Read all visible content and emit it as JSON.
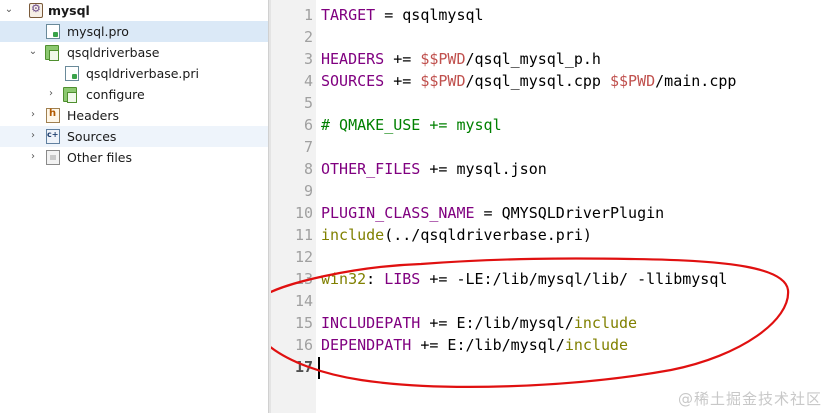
{
  "project_tree": {
    "items": [
      {
        "label": "mysql",
        "kind": "project",
        "expanded": true
      },
      {
        "label": "mysql.pro",
        "kind": "pro-file",
        "selected": true
      },
      {
        "label": "qsqldriverbase",
        "kind": "subproject",
        "expanded": true
      },
      {
        "label": "qsqldriverbase.pri",
        "kind": "pri-file"
      },
      {
        "label": "configure",
        "kind": "subproject",
        "expanded": false
      },
      {
        "label": "Headers",
        "kind": "headers-folder",
        "expanded": false
      },
      {
        "label": "Sources",
        "kind": "sources-folder",
        "expanded": false
      },
      {
        "label": "Other files",
        "kind": "other-folder",
        "expanded": false
      }
    ]
  },
  "editor": {
    "current_line": 17,
    "lines": [
      {
        "n": "1",
        "text": "TARGET = qsqlmysql"
      },
      {
        "n": "2",
        "text": ""
      },
      {
        "n": "3",
        "text": "HEADERS += $$PWD/qsql_mysql_p.h"
      },
      {
        "n": "4",
        "text": "SOURCES += $$PWD/qsql_mysql.cpp $$PWD/main.cpp"
      },
      {
        "n": "5",
        "text": ""
      },
      {
        "n": "6",
        "text": "# QMAKE_USE += mysql"
      },
      {
        "n": "7",
        "text": ""
      },
      {
        "n": "8",
        "text": "OTHER_FILES += mysql.json"
      },
      {
        "n": "9",
        "text": ""
      },
      {
        "n": "10",
        "text": "PLUGIN_CLASS_NAME = QMYSQLDriverPlugin"
      },
      {
        "n": "11",
        "text": "include(../qsqldriverbase.pri)"
      },
      {
        "n": "12",
        "text": ""
      },
      {
        "n": "13",
        "text": "win32: LIBS += -LE:/lib/mysql/lib/ -llibmysql"
      },
      {
        "n": "14",
        "text": ""
      },
      {
        "n": "15",
        "text": "INCLUDEPATH += E:/lib/mysql/include"
      },
      {
        "n": "16",
        "text": "DEPENDPATH += E:/lib/mysql/include"
      },
      {
        "n": "17",
        "text": ""
      }
    ]
  },
  "watermark": "@稀土掘金技术社区",
  "colors": {
    "variable": "#800080",
    "pwd_env": "#c0504d",
    "comment": "#008000",
    "function": "#808000",
    "annotation_oval": "#e01010",
    "selection": "#dbe9f7"
  }
}
